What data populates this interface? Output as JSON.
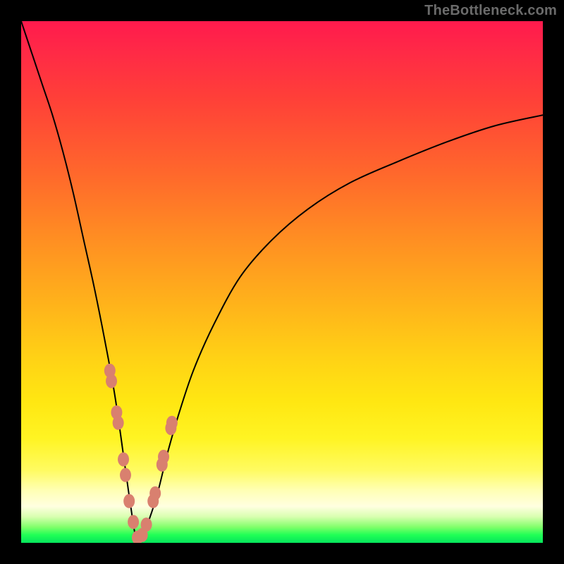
{
  "watermark": "TheBottleneck.com",
  "colors": {
    "background_border": "#000000",
    "curve_stroke": "#000000",
    "marker_fill": "#d9806f",
    "marker_stroke": "#c96a5a",
    "gradient_top": "#ff1a4d",
    "gradient_bottom": "#06e45c"
  },
  "chart_data": {
    "type": "line",
    "title": "",
    "xlabel": "",
    "ylabel": "",
    "x_range": [
      0,
      100
    ],
    "y_range": [
      0,
      100
    ],
    "description": "V-shaped bottleneck curve. y goes from ~100 at x≈0 sharply down to ~0 near x≈22 then rises with decreasing slope toward ~82 at x=100.",
    "series": [
      {
        "name": "bottleneck-curve",
        "x": [
          0,
          2,
          4,
          6,
          8,
          10,
          12,
          14,
          16,
          18,
          20,
          21,
          22,
          23,
          24,
          26,
          28,
          30,
          33,
          37,
          42,
          48,
          55,
          63,
          72,
          82,
          91,
          100
        ],
        "y": [
          100,
          94,
          88,
          82,
          75,
          67,
          58,
          49,
          39,
          28,
          14,
          7,
          1,
          1,
          3,
          9,
          17,
          24,
          33,
          42,
          51,
          58,
          64,
          69,
          73,
          77,
          80,
          82
        ]
      }
    ],
    "markers": {
      "name": "highlighted-points",
      "x": [
        17.0,
        17.3,
        18.3,
        18.6,
        19.6,
        20.0,
        20.7,
        21.5,
        22.3,
        23.2,
        24.0,
        25.3,
        25.7,
        27.0,
        27.3,
        28.7,
        28.9
      ],
      "y": [
        33.0,
        31.0,
        25.0,
        23.0,
        16.0,
        13.0,
        8.0,
        4.0,
        1.0,
        1.5,
        3.5,
        8.0,
        9.5,
        15.0,
        16.5,
        22.0,
        23.0
      ]
    }
  }
}
